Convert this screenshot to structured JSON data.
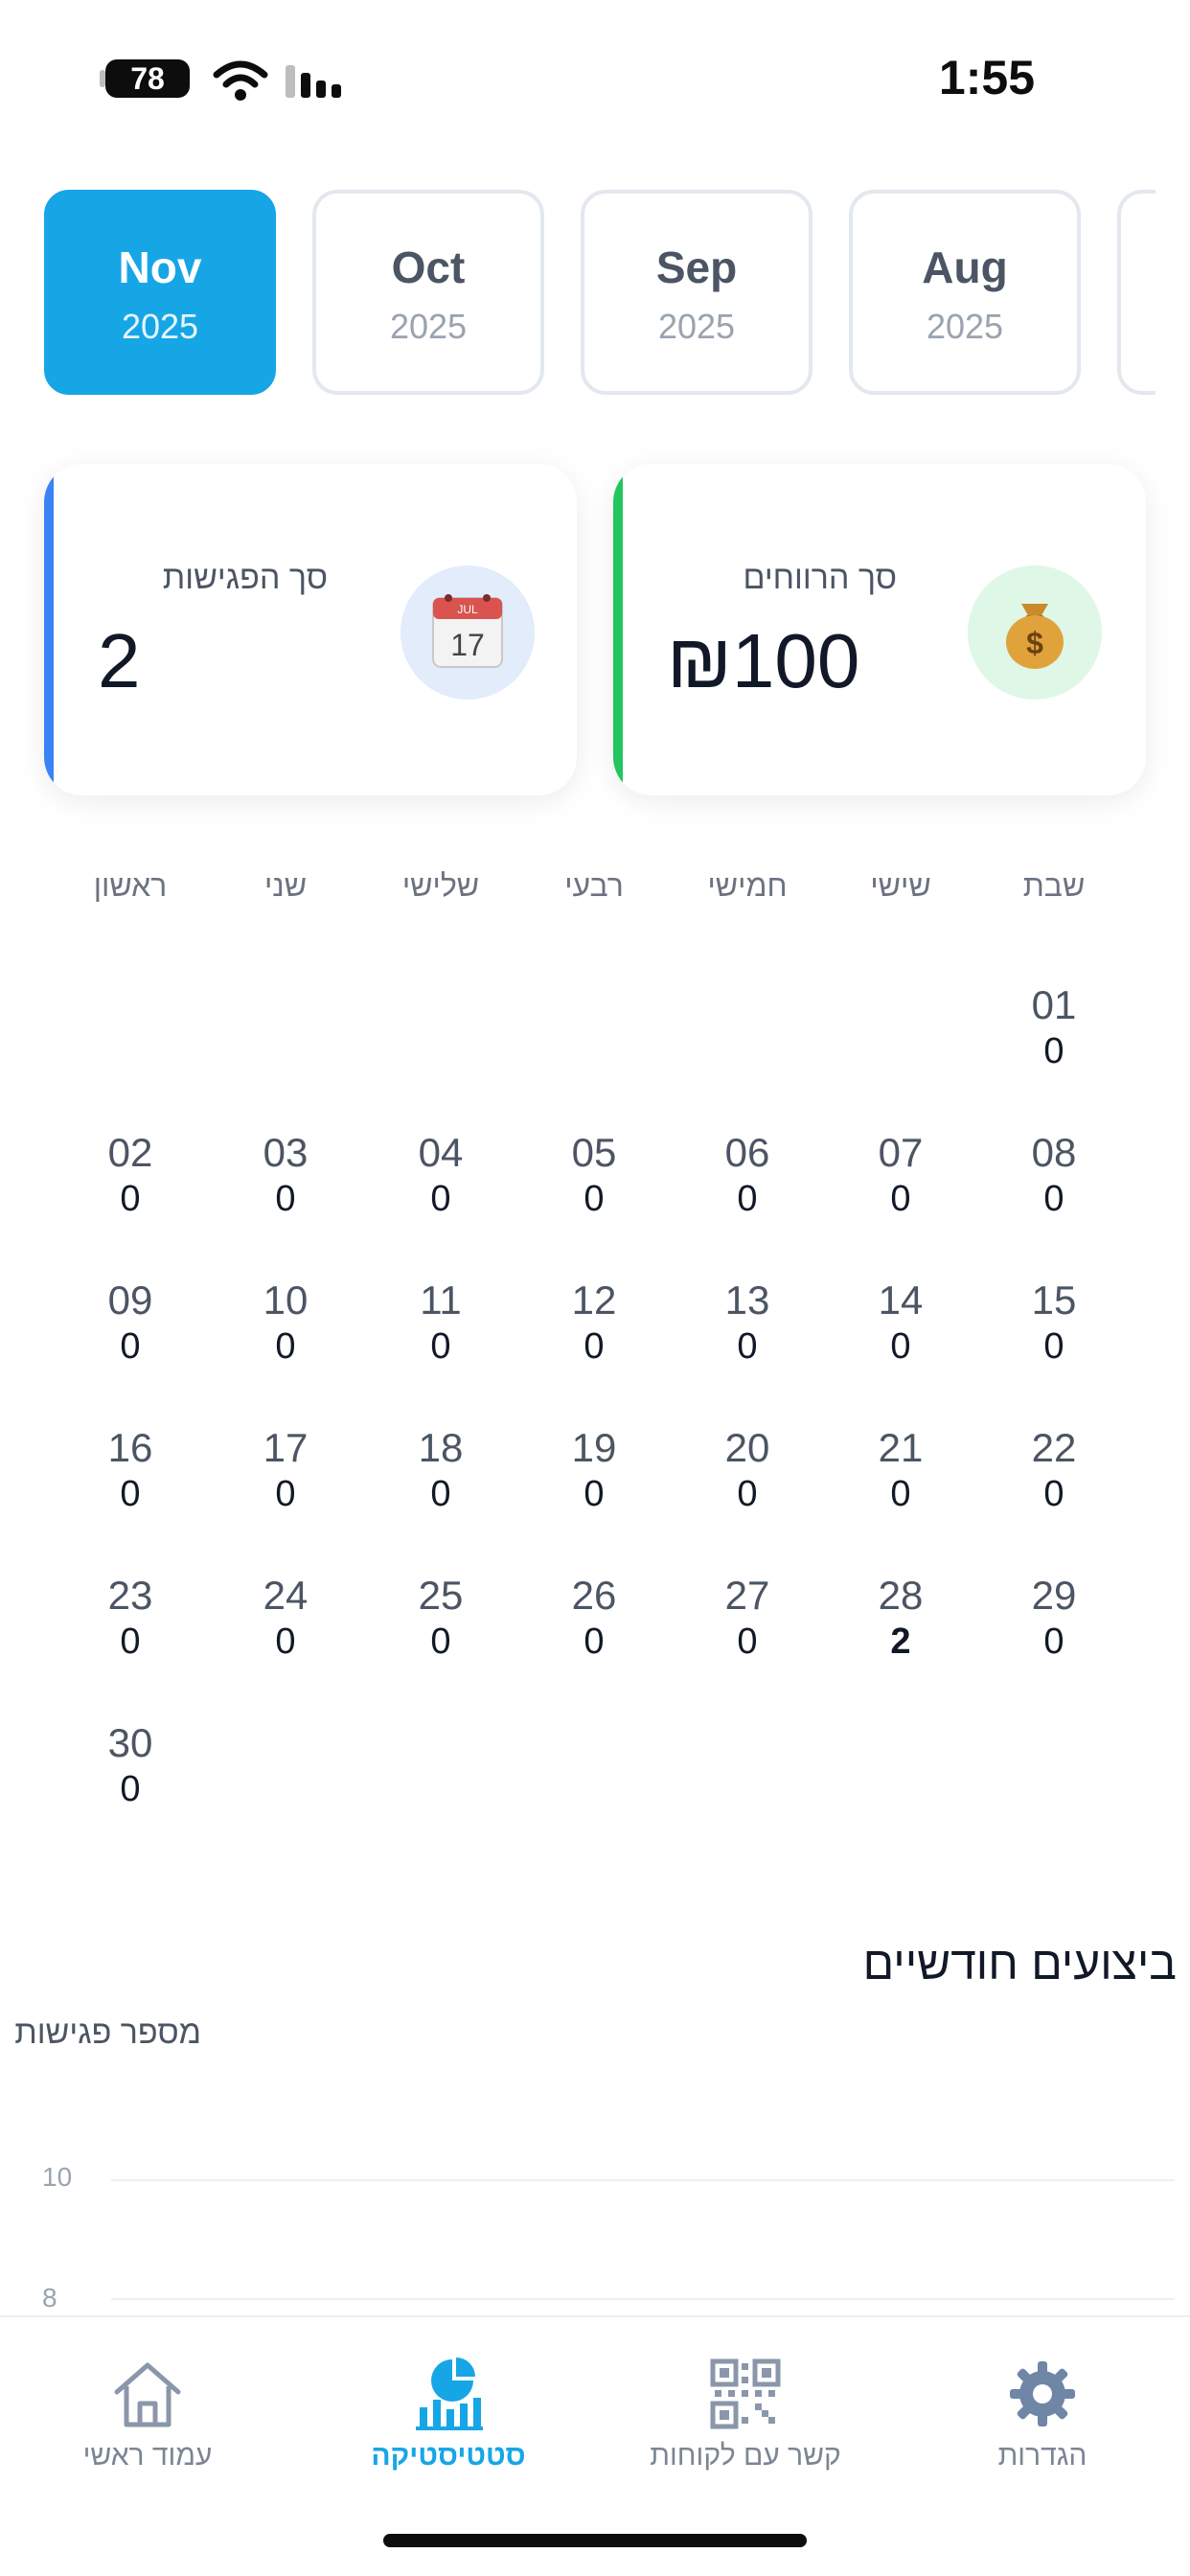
{
  "status_bar": {
    "battery": "78",
    "time": "1:55"
  },
  "months": [
    {
      "month": "Nov",
      "year": "2025",
      "active": true
    },
    {
      "month": "Oct",
      "year": "2025",
      "active": false
    },
    {
      "month": "Sep",
      "year": "2025",
      "active": false
    },
    {
      "month": "Aug",
      "year": "2025",
      "active": false
    }
  ],
  "summary": {
    "meetings": {
      "label": "סך הפגישות",
      "value": "2",
      "icon": "calendar-icon",
      "accent": "#3b82f6",
      "icon_bg": "#e2ecfb"
    },
    "revenue": {
      "label": "סך הרווחים",
      "value": "₪100",
      "icon": "money-bag-icon",
      "accent": "#22c55e",
      "icon_bg": "#dff7e7"
    }
  },
  "weekdays": [
    "ראשון",
    "שני",
    "שלישי",
    "רבעי",
    "חמישי",
    "שישי",
    "שבת"
  ],
  "calendar": [
    {
      "day": "01",
      "count": "0"
    },
    {
      "day": "02",
      "count": "0"
    },
    {
      "day": "03",
      "count": "0"
    },
    {
      "day": "04",
      "count": "0"
    },
    {
      "day": "05",
      "count": "0"
    },
    {
      "day": "06",
      "count": "0"
    },
    {
      "day": "07",
      "count": "0"
    },
    {
      "day": "08",
      "count": "0"
    },
    {
      "day": "09",
      "count": "0"
    },
    {
      "day": "10",
      "count": "0"
    },
    {
      "day": "11",
      "count": "0"
    },
    {
      "day": "12",
      "count": "0"
    },
    {
      "day": "13",
      "count": "0"
    },
    {
      "day": "14",
      "count": "0"
    },
    {
      "day": "15",
      "count": "0"
    },
    {
      "day": "16",
      "count": "0"
    },
    {
      "day": "17",
      "count": "0"
    },
    {
      "day": "18",
      "count": "0"
    },
    {
      "day": "19",
      "count": "0"
    },
    {
      "day": "20",
      "count": "0"
    },
    {
      "day": "21",
      "count": "0"
    },
    {
      "day": "22",
      "count": "0"
    },
    {
      "day": "23",
      "count": "0"
    },
    {
      "day": "24",
      "count": "0"
    },
    {
      "day": "25",
      "count": "0"
    },
    {
      "day": "26",
      "count": "0"
    },
    {
      "day": "27",
      "count": "0"
    },
    {
      "day": "28",
      "count": "2"
    },
    {
      "day": "29",
      "count": "0"
    },
    {
      "day": "30",
      "count": "0"
    }
  ],
  "chart_section": {
    "title": "ביצועים חודשיים",
    "y_axis_title": "מספר פגישות",
    "y_ticks": [
      "10",
      "8"
    ]
  },
  "nav": [
    {
      "label": "הגדרות",
      "icon": "gear-icon",
      "active": false
    },
    {
      "label": "קשר עם לקוחות",
      "icon": "qr-code-icon",
      "active": false
    },
    {
      "label": "סטטיסטיקה",
      "icon": "pie-chart-icon",
      "active": true
    },
    {
      "label": "עמוד ראשי",
      "icon": "home-icon",
      "active": false
    }
  ],
  "colors": {
    "accent": "#16a6e6",
    "blue_stripe": "#3b82f6",
    "green_stripe": "#22c55e"
  }
}
